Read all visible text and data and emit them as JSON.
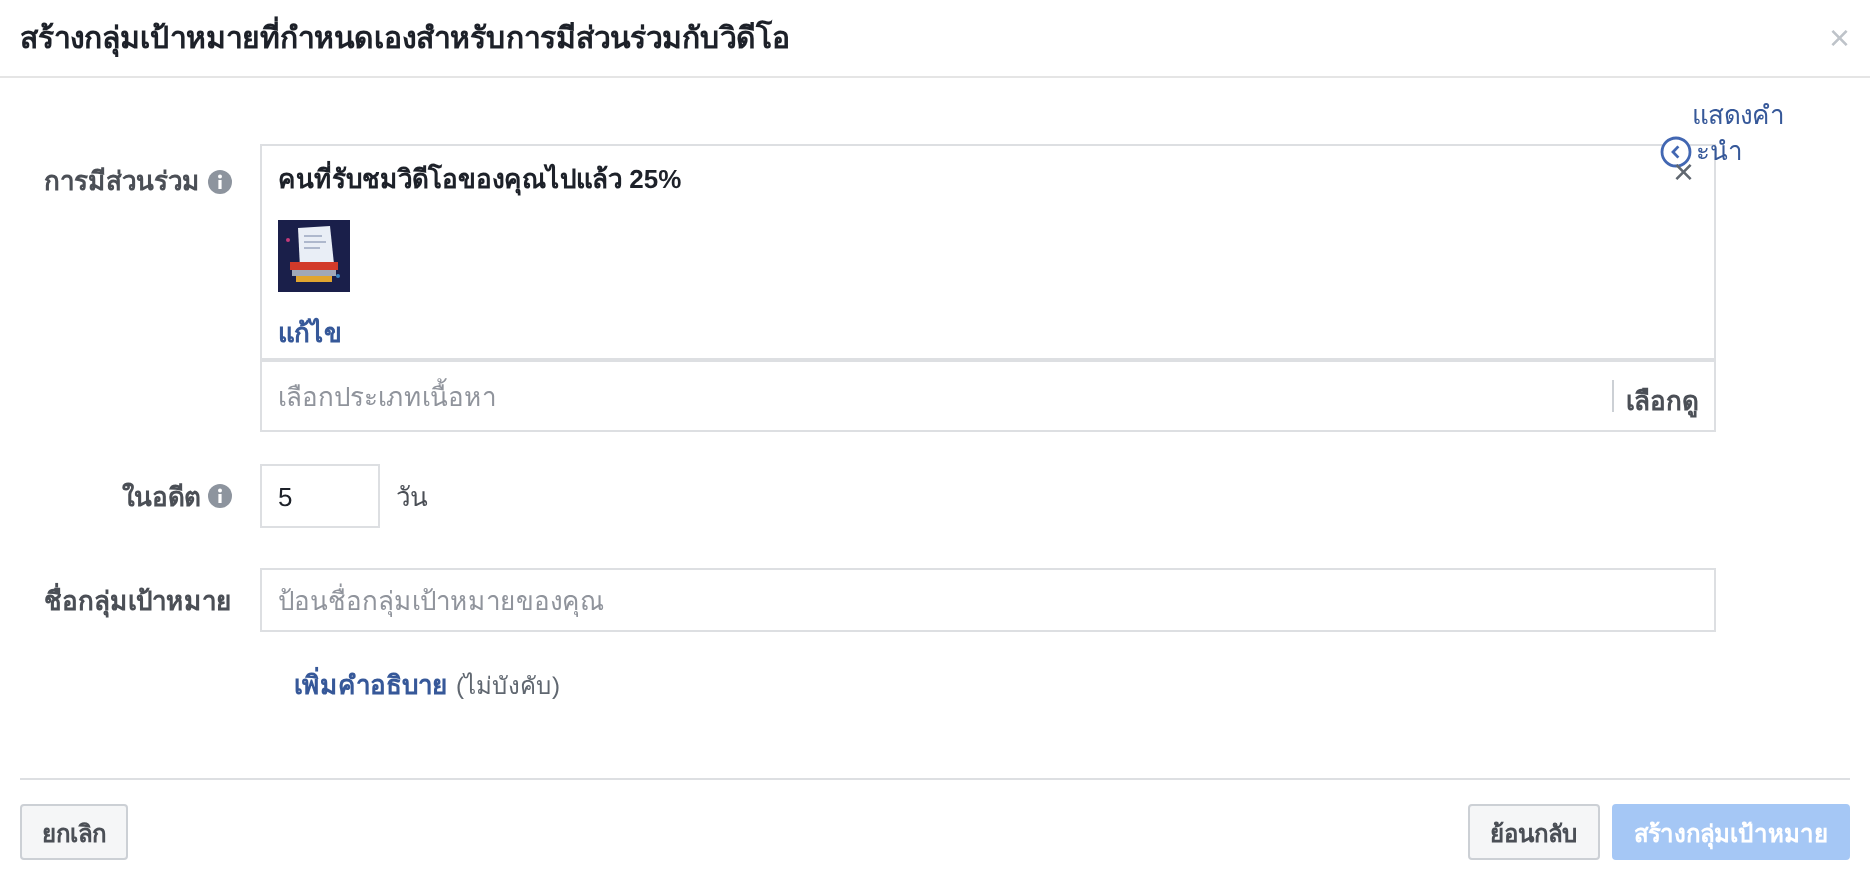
{
  "dialog": {
    "title": "สร้างกลุ่มเป้าหมายที่กำหนดเองสำหรับการมีส่วนร่วมกับวิดีโอ",
    "close": "×"
  },
  "hint_toggle": {
    "lines": [
      "แสดงคำ",
      "ะนำ"
    ]
  },
  "engagement": {
    "label": "การมีส่วนร่วม",
    "rule": {
      "title": "คนที่รับชมวิดีโอของคุณไปแล้ว 25%",
      "remove": "×",
      "edit": "แก้ไข"
    },
    "content_type": {
      "placeholder": "เลือกประเภทเนื้อหา",
      "browse": "เลือกดู"
    }
  },
  "past": {
    "label": "ในอดีต",
    "value": "5",
    "unit": "วัน"
  },
  "name": {
    "label": "ชื่อกลุ่มเป้าหมาย",
    "placeholder": "ป้อนชื่อกลุ่มเป้าหมายของคุณ"
  },
  "description": {
    "link": "เพิ่มคำอธิบาย",
    "note": "(ไม่บังคับ)"
  },
  "footer": {
    "cancel": "ยกเลิก",
    "back": "ย้อนกลับ",
    "create": {
      "label": "สร้างกลุ่มเป้าหมาย",
      "disabled": true
    }
  }
}
